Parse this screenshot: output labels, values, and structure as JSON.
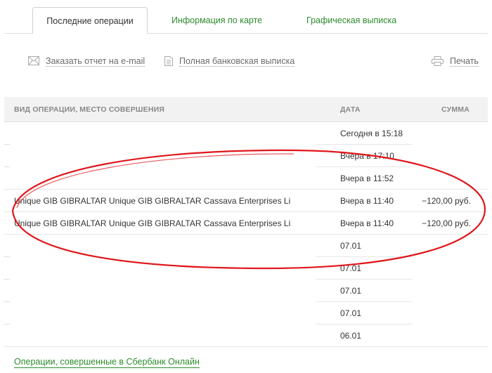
{
  "tabs": [
    {
      "label": "Последние операции",
      "active": true
    },
    {
      "label": "Информация по карте",
      "active": false
    },
    {
      "label": "Графическая выписка",
      "active": false
    }
  ],
  "actions": {
    "email_report": "Заказать отчет на e-mail",
    "full_statement": "Полная банковская выписка",
    "print": "Печать"
  },
  "table": {
    "columns": [
      "ВИД ОПЕРАЦИИ, МЕСТО СОВЕРШЕНИЯ",
      "ДАТА",
      "СУММА"
    ],
    "rows": [
      {
        "desc": "",
        "date": "Сегодня в 15:18",
        "amount": ""
      },
      {
        "desc": "",
        "date": "Вчера в 17:10",
        "amount": ""
      },
      {
        "desc": "",
        "date": "Вчера в 11:52",
        "amount": ""
      },
      {
        "desc": "Unique GIB GIBRALTAR Unique GIB GIBRALTAR Cassava Enterprises Li",
        "date": "Вчера в 11:40",
        "amount": "−120,00 руб."
      },
      {
        "desc": "Unique GIB GIBRALTAR Unique GIB GIBRALTAR Cassava Enterprises Li",
        "date": "Вчера в 11:40",
        "amount": "−120,00 руб."
      },
      {
        "desc": "",
        "date": "07.01",
        "amount": ""
      },
      {
        "desc": "",
        "date": "07.01",
        "amount": ""
      },
      {
        "desc": "",
        "date": "07.01",
        "amount": ""
      },
      {
        "desc": "",
        "date": "07.01",
        "amount": ""
      },
      {
        "desc": "",
        "date": "06.01",
        "amount": ""
      }
    ]
  },
  "footer": {
    "link": "Операции, совершенные в Сбербанк Онлайн"
  },
  "colors": {
    "accent_green": "#2c8b2c",
    "highlight_red": "#e0161b",
    "header_bg": "#f2f2f2"
  },
  "icons": [
    "envelope-icon",
    "document-icon",
    "printer-icon"
  ]
}
